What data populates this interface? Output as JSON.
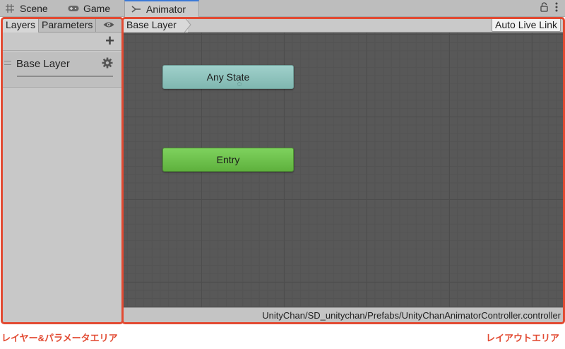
{
  "window_tabs": [
    {
      "label": "Scene",
      "icon": "grid-icon"
    },
    {
      "label": "Game",
      "icon": "gamepad-icon"
    },
    {
      "label": "Animator",
      "icon": "animator-icon",
      "active": true
    }
  ],
  "left_panel": {
    "tabs": [
      {
        "label": "Layers",
        "active": true
      },
      {
        "label": "Parameters"
      }
    ],
    "visibility_icon": "eye-icon",
    "add_icon": "plus-icon",
    "layers": [
      {
        "name": "Base Layer",
        "settings_icon": "gear-icon"
      }
    ]
  },
  "main": {
    "breadcrumb": "Base Layer",
    "auto_live_link": "Auto Live Link",
    "nodes": [
      {
        "label": "Any State",
        "color": "#8fc4be"
      },
      {
        "label": "Entry",
        "color": "#6cc249"
      }
    ],
    "controller_path": "UnityChan/SD_unitychan/Prefabs/UnityChanAnimatorController.controller"
  },
  "annotations": {
    "left_caption": "レイヤー&パラメータエリア",
    "right_caption": "レイアウトエリア",
    "color": "#e24a32"
  }
}
